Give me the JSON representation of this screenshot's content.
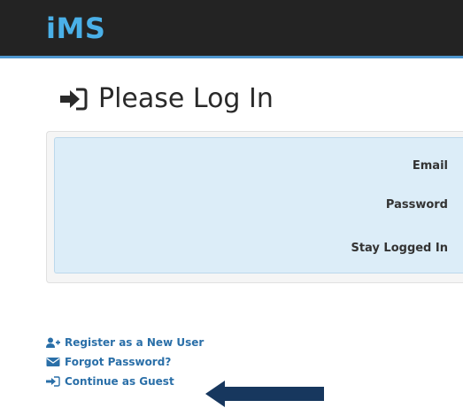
{
  "app": {
    "brand": "iMS",
    "brand_color": "#4ab0e8",
    "navbar_color": "#232323"
  },
  "login": {
    "title": "Please Log In",
    "title_icon": "sign-in-icon",
    "fields": {
      "email_label": "Email",
      "password_label": "Password",
      "stay_logged_in_label": "Stay Logged In"
    }
  },
  "links": {
    "register": {
      "label": "Register as a New User",
      "icon": "user-plus-icon"
    },
    "forgot": {
      "label": "Forgot Password?",
      "icon": "envelope-icon"
    },
    "guest": {
      "label": "Continue as Guest",
      "icon": "sign-in-icon"
    }
  },
  "annotation": {
    "arrow_color": "#17375e"
  }
}
